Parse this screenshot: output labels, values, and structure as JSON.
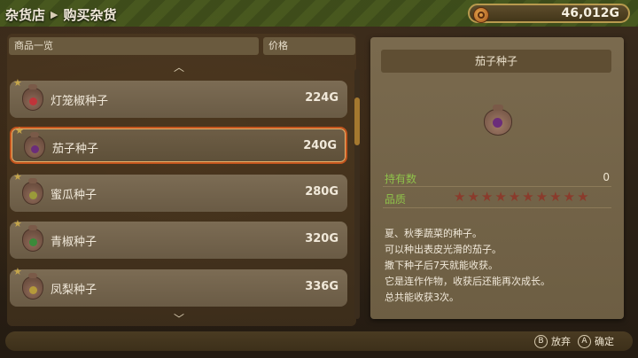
{
  "breadcrumb": {
    "parent": "杂货店",
    "current": "购买杂货"
  },
  "money": {
    "amount": "46,012G",
    "icon": "coin-icon"
  },
  "list": {
    "col_name": "商品一览",
    "col_price": "价格",
    "items": [
      {
        "name": "灯笼椒种子",
        "price": "224G",
        "seed_color": "#c0343a"
      },
      {
        "name": "茄子种子",
        "price": "240G",
        "seed_color": "#6b2d7a",
        "selected": true
      },
      {
        "name": "蜜瓜种子",
        "price": "280G",
        "seed_color": "#9a9a3a"
      },
      {
        "name": "青椒种子",
        "price": "320G",
        "seed_color": "#3b8a3a"
      },
      {
        "name": "凤梨种子",
        "price": "336G",
        "seed_color": "#b59a3a"
      }
    ]
  },
  "detail": {
    "title": "茄子种子",
    "owned_label": "持有数",
    "owned_value": "0",
    "quality_label": "品质",
    "quality_stars": 10,
    "description": [
      "夏、秋季蔬菜的种子。",
      "可以种出表皮光滑的茄子。",
      "撒下种子后7天就能收获。",
      "它是连作作物，收获后还能再次成长。",
      "总共能收获3次。"
    ]
  },
  "footer": {
    "abandon_key": "B",
    "abandon_label": "放弃",
    "confirm_key": "A",
    "confirm_label": "确定"
  }
}
